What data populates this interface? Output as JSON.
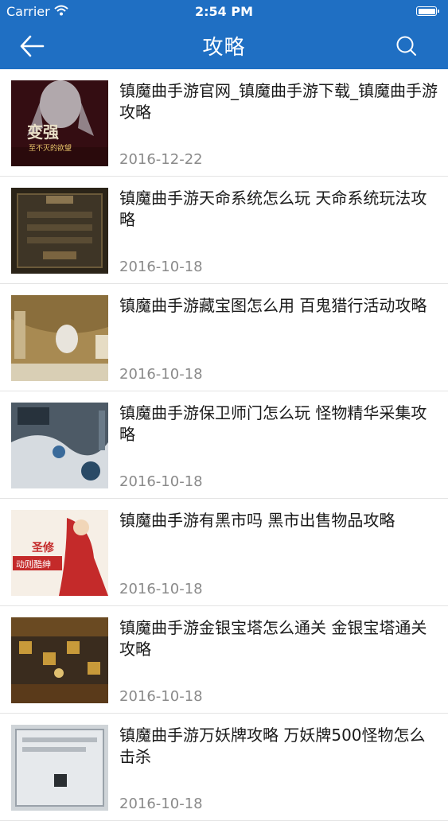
{
  "status_bar": {
    "carrier": "Carrier",
    "time": "2:54 PM"
  },
  "nav": {
    "title": "攻略"
  },
  "articles": [
    {
      "title": "镇魔曲手游官网_镇魔曲手游下载_镇魔曲手游攻略",
      "date": "2016-12-22",
      "thumb_text": [
        "变强",
        "至不灭的欲望"
      ]
    },
    {
      "title": "镇魔曲手游天命系统怎么玩 天命系统玩法攻略",
      "date": "2016-10-18"
    },
    {
      "title": "镇魔曲手游藏宝图怎么用 百鬼猎行活动攻略",
      "date": "2016-10-18"
    },
    {
      "title": "镇魔曲手游保卫师门怎么玩 怪物精华采集攻略",
      "date": "2016-10-18"
    },
    {
      "title": "镇魔曲手游有黑市吗 黑市出售物品攻略",
      "date": "2016-10-18",
      "thumb_text": [
        "圣修",
        "动则酷绅"
      ]
    },
    {
      "title": "镇魔曲手游金银宝塔怎么通关 金银宝塔通关攻略",
      "date": "2016-10-18"
    },
    {
      "title": "镇魔曲手游万妖牌攻略 万妖牌500怪物怎么击杀",
      "date": "2016-10-18"
    }
  ],
  "colors": {
    "header": "#1f6fc3",
    "date": "#8a8a8a",
    "divider": "#e4e4e4"
  },
  "icons": {
    "back": "arrow-left-icon",
    "search": "search-icon",
    "wifi": "wifi-icon",
    "battery": "battery-icon"
  }
}
